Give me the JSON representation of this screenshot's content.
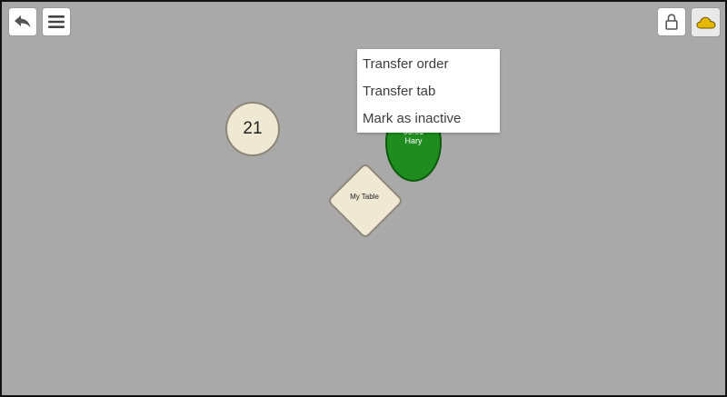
{
  "toolbar": {
    "left": [
      {
        "icon": "back-arrow-icon"
      },
      {
        "icon": "hamburger-menu-icon"
      }
    ],
    "right": [
      {
        "icon": "lock-icon"
      },
      {
        "icon": "cloud-icon",
        "color": "#e6b800"
      }
    ]
  },
  "floor": {
    "background": "#a9a9a9",
    "tables": [
      {
        "shape": "circle",
        "label": "21",
        "color": "#efe8d3"
      },
      {
        "shape": "circle",
        "time": "05:01",
        "server": "Hary",
        "color": "#1e8c1e"
      },
      {
        "shape": "diamond",
        "label": "My Table",
        "color": "#efe8d3"
      }
    ]
  },
  "context_menu": {
    "items": [
      {
        "label": "Transfer order"
      },
      {
        "label": "Transfer tab"
      },
      {
        "label": "Mark as inactive"
      }
    ]
  }
}
